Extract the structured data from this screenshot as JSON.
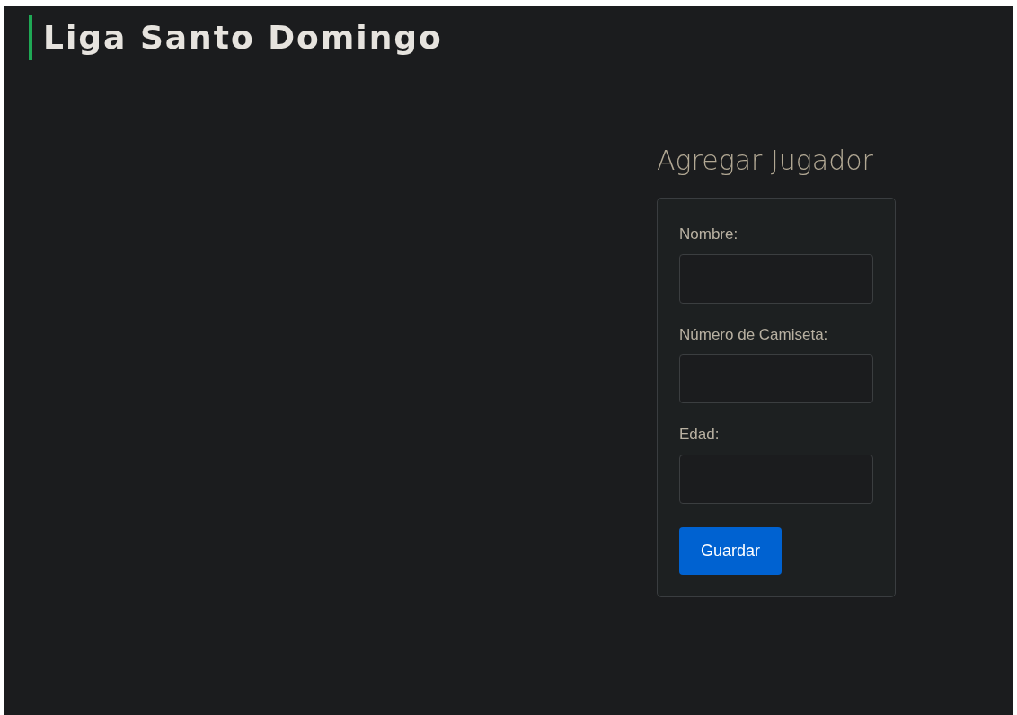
{
  "site_title": "Liga Santo Domingo",
  "form": {
    "heading": "Agregar Jugador",
    "fields": [
      {
        "label": "Nombre:"
      },
      {
        "label": "Número de Camiseta:"
      },
      {
        "label": "Edad:"
      }
    ],
    "submit": "Guardar"
  }
}
